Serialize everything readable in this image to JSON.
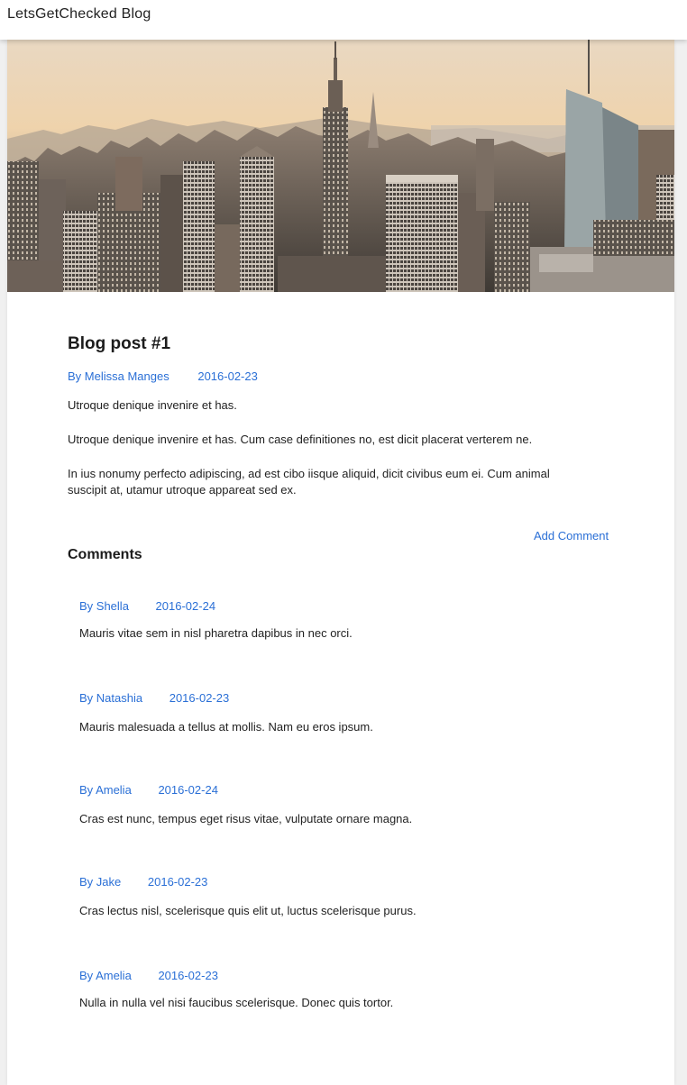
{
  "header": {
    "brand": "LetsGetChecked Blog"
  },
  "post": {
    "title": "Blog post #1",
    "author": "By Melissa Manges",
    "date": "2016-02-23",
    "paragraphs": [
      "Utroque denique invenire et has.",
      "Utroque denique invenire et has. Cum case definitiones no, est dicit placerat verterem ne.",
      "In ius nonumy perfecto adipiscing, ad est cibo iisque aliquid, dicit civibus eum ei. Cum animal suscipit at, utamur utroque appareat sed ex."
    ]
  },
  "comments_section": {
    "add_label": "Add Comment",
    "title": "Comments",
    "items": [
      {
        "author": "By Shella",
        "date": "2016-02-24",
        "text": "Mauris vitae sem in nisl pharetra dapibus in nec orci."
      },
      {
        "author": "By Natashia",
        "date": "2016-02-23",
        "text": "Mauris malesuada a tellus at mollis. Nam eu eros ipsum."
      },
      {
        "author": "By Amelia",
        "date": "2016-02-24",
        "text": "Cras est nunc, tempus eget risus vitae, vulputate ornare magna."
      },
      {
        "author": "By Jake",
        "date": "2016-02-23",
        "text": "Cras lectus nisl, scelerisque quis elit ut, luctus scelerisque purus."
      },
      {
        "author": "By Amelia",
        "date": "2016-02-23",
        "text": "Nulla in nulla vel nisi faucibus scelerisque. Donec quis tortor."
      }
    ]
  },
  "colors": {
    "link": "#2a6fd6",
    "text": "#222222",
    "heading": "#1c1c1c"
  }
}
